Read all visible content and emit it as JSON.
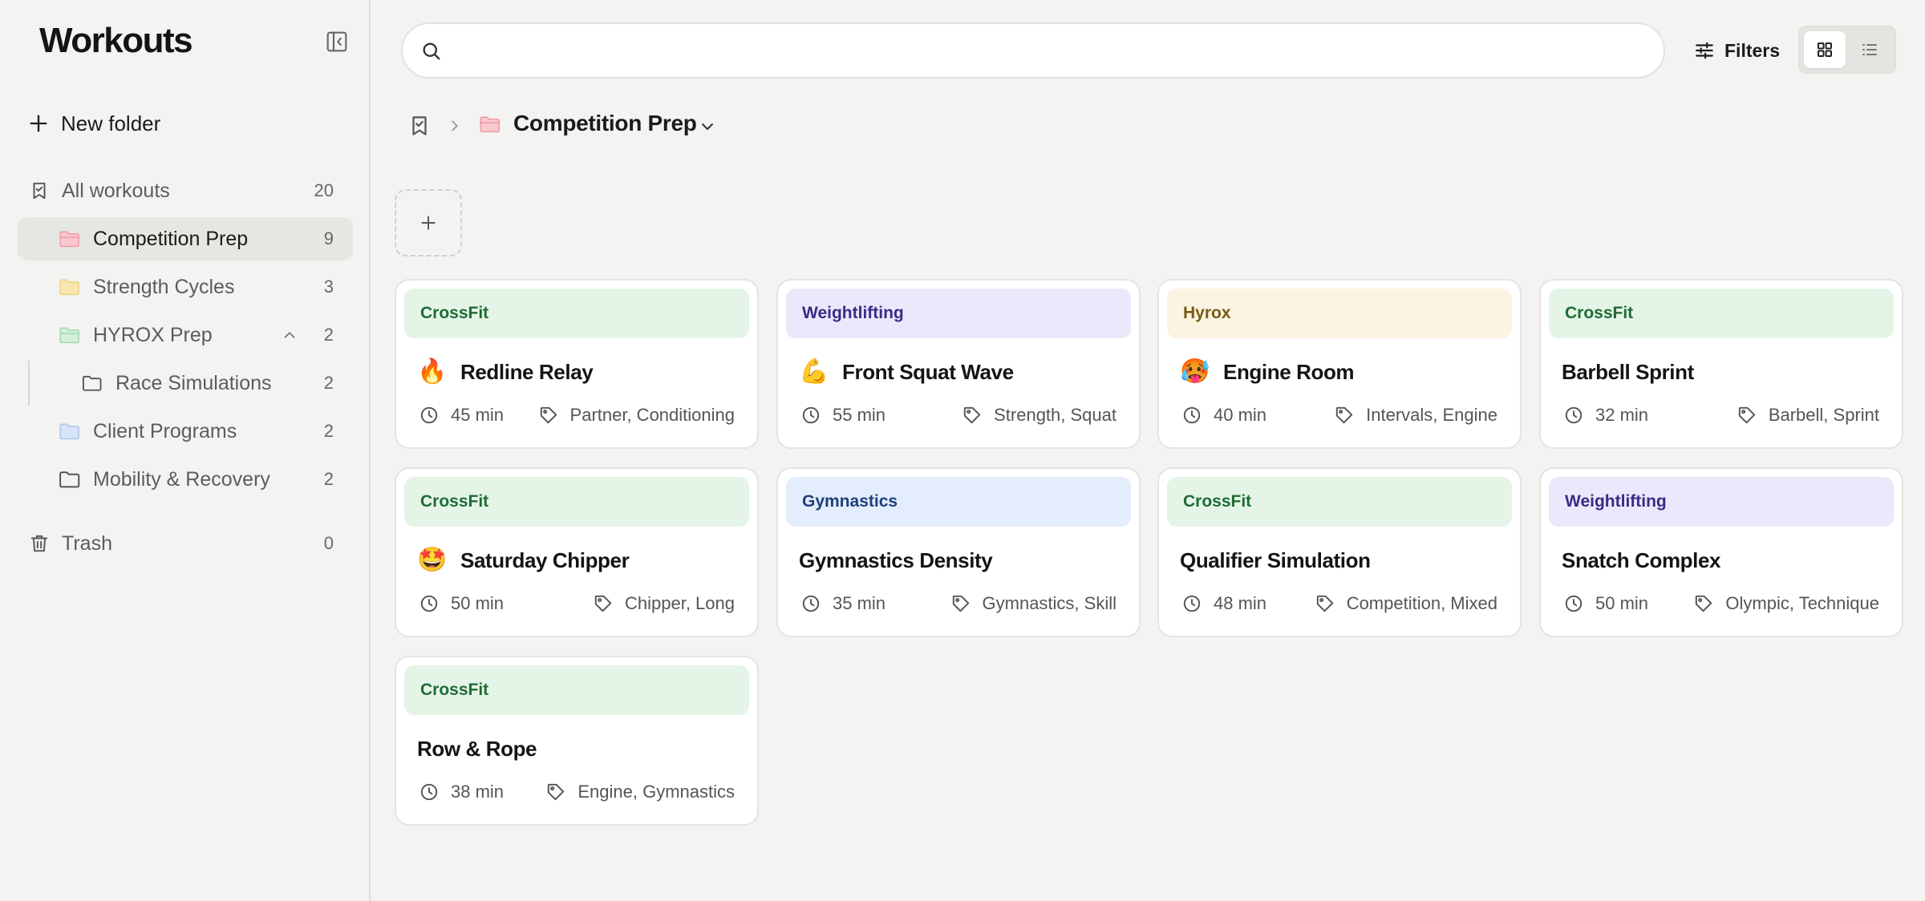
{
  "app": {
    "title": "Workouts"
  },
  "sidebar": {
    "new_folder_label": "New folder",
    "all_workouts": {
      "label": "All workouts",
      "count": "20"
    },
    "folders": [
      {
        "label": "Competition Prep",
        "count": "9",
        "color": "#f2a3ad",
        "active": true
      },
      {
        "label": "Strength Cycles",
        "count": "3",
        "color": "#f3d98a"
      },
      {
        "label": "HYROX Prep",
        "count": "2",
        "color": "#a9dcb3",
        "expanded": true
      },
      {
        "label": "Race Simulations",
        "count": "2",
        "color": "outline"
      },
      {
        "label": "Client Programs",
        "count": "2",
        "color": "#b9d0ee"
      },
      {
        "label": "Mobility & Recovery",
        "count": "2",
        "color": "outline"
      }
    ],
    "trash": {
      "label": "Trash",
      "count": "0"
    }
  },
  "toolbar": {
    "search_placeholder": "",
    "filters_label": "Filters",
    "view_mode": "grid"
  },
  "breadcrumb": {
    "current": "Competition Prep",
    "folder_color": "#f2a3ad"
  },
  "workouts": [
    {
      "category": "CrossFit",
      "emoji": "🔥",
      "title": "Redline Relay",
      "duration": "45 min",
      "tags": "Partner, Conditioning"
    },
    {
      "category": "Weightlifting",
      "emoji": "💪",
      "title": "Front Squat Wave",
      "duration": "55 min",
      "tags": "Strength, Squat"
    },
    {
      "category": "Hyrox",
      "emoji": "🥵",
      "title": "Engine Room",
      "duration": "40 min",
      "tags": "Intervals, Engine"
    },
    {
      "category": "CrossFit",
      "emoji": "",
      "title": "Barbell Sprint",
      "duration": "32 min",
      "tags": "Barbell, Sprint"
    },
    {
      "category": "CrossFit",
      "emoji": "🤩",
      "title": "Saturday Chipper",
      "duration": "50 min",
      "tags": "Chipper, Long"
    },
    {
      "category": "Gymnastics",
      "emoji": "",
      "title": "Gymnastics Density",
      "duration": "35 min",
      "tags": "Gymnastics, Skill"
    },
    {
      "category": "CrossFit",
      "emoji": "",
      "title": "Qualifier Simulation",
      "duration": "48 min",
      "tags": "Competition, Mixed"
    },
    {
      "category": "Weightlifting",
      "emoji": "",
      "title": "Snatch Complex",
      "duration": "50 min",
      "tags": "Olympic, Technique"
    },
    {
      "category": "CrossFit",
      "emoji": "",
      "title": "Row & Rope",
      "duration": "38 min",
      "tags": "Engine, Gymnastics"
    }
  ],
  "icons": {
    "search": "search-icon",
    "filters": "sliders-icon",
    "grid": "grid-icon",
    "list": "list-icon",
    "folder": "folder-icon",
    "bookmark": "bookmark-check-icon",
    "trash": "trash-icon",
    "clock": "clock-icon",
    "tag": "tag-icon",
    "plus": "plus-icon"
  }
}
